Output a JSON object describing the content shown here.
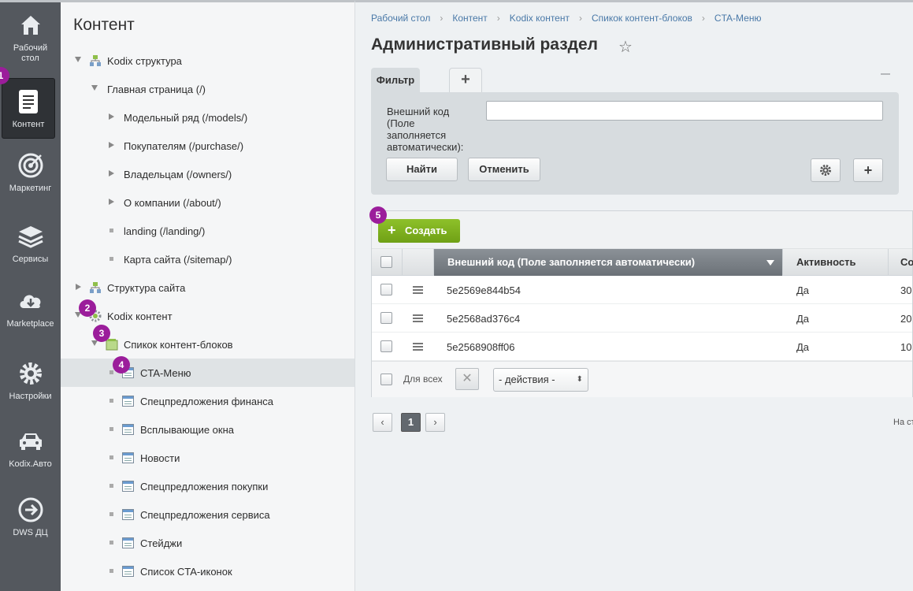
{
  "sidebar": {
    "items": [
      {
        "label": "Рабочий\nстол",
        "icon": "house-icon"
      },
      {
        "label": "Контент",
        "icon": "document-icon"
      },
      {
        "label": "Маркетинг",
        "icon": "target-icon"
      },
      {
        "label": "Сервисы",
        "icon": "layers-icon"
      },
      {
        "label": "Marketplace",
        "icon": "cloud-download-icon"
      },
      {
        "label": "Настройки",
        "icon": "gear-icon"
      },
      {
        "label": "Kodix.Авто",
        "icon": "car-icon"
      },
      {
        "label": "DWS ДЦ",
        "icon": "arrow-circle-icon"
      }
    ]
  },
  "badges": [
    "1",
    "2",
    "3",
    "4",
    "5"
  ],
  "tree": {
    "title": "Контент",
    "rows": [
      {
        "label": "Kodix структура"
      },
      {
        "label": "Главная страница (/)"
      },
      {
        "label": "Модельный ряд (/models/)"
      },
      {
        "label": "Покупателям (/purchase/)"
      },
      {
        "label": "Владельцам (/owners/)"
      },
      {
        "label": "О компании (/about/)"
      },
      {
        "label": "landing (/landing/)"
      },
      {
        "label": "Карта сайта (/sitemap/)"
      },
      {
        "label": "Структура сайта"
      },
      {
        "label": "Kodix контент"
      },
      {
        "label": "Спикок контент-блоков"
      },
      {
        "label": "CTA-Меню"
      },
      {
        "label": "Спецпредложения финанса"
      },
      {
        "label": "Всплывающие окна"
      },
      {
        "label": "Новости"
      },
      {
        "label": "Спецпредложения покупки"
      },
      {
        "label": "Спецпредложения сервиса"
      },
      {
        "label": "Стейджи"
      },
      {
        "label": "Список CTA-иконок"
      }
    ]
  },
  "main": {
    "breadcrumbs": [
      "Рабочий стол",
      "Контент",
      "Kodix контент",
      "Спикок контент-блоков",
      "CTA-Меню"
    ],
    "title": "Административный раздел",
    "star": "☆",
    "filter": {
      "tab_label": "Фильтр",
      "add_tab": "+",
      "field_label": "Внешний код (Поле заполняется автоматически):",
      "field_value": "",
      "find_label": "Найти",
      "cancel_label": "Отменить",
      "add_label": "+"
    },
    "grid": {
      "create_label": "Создать",
      "columns": [
        "Внешний код (Поле заполняется автоматически)",
        "Активность",
        "Со"
      ],
      "rows": [
        {
          "code": "5e2569e844b54",
          "active": "Да",
          "sort": "30"
        },
        {
          "code": "5e2568ad376c4",
          "active": "Да",
          "sort": "20"
        },
        {
          "code": "5e2568908ff06",
          "active": "Да",
          "sort": "10"
        }
      ],
      "for_all_label": "Для всех",
      "clear_label": "✕",
      "actions_label": "- действия -"
    },
    "pager": {
      "prev": "‹",
      "current": "1",
      "next": "›",
      "on_page_label": "На ст"
    }
  }
}
